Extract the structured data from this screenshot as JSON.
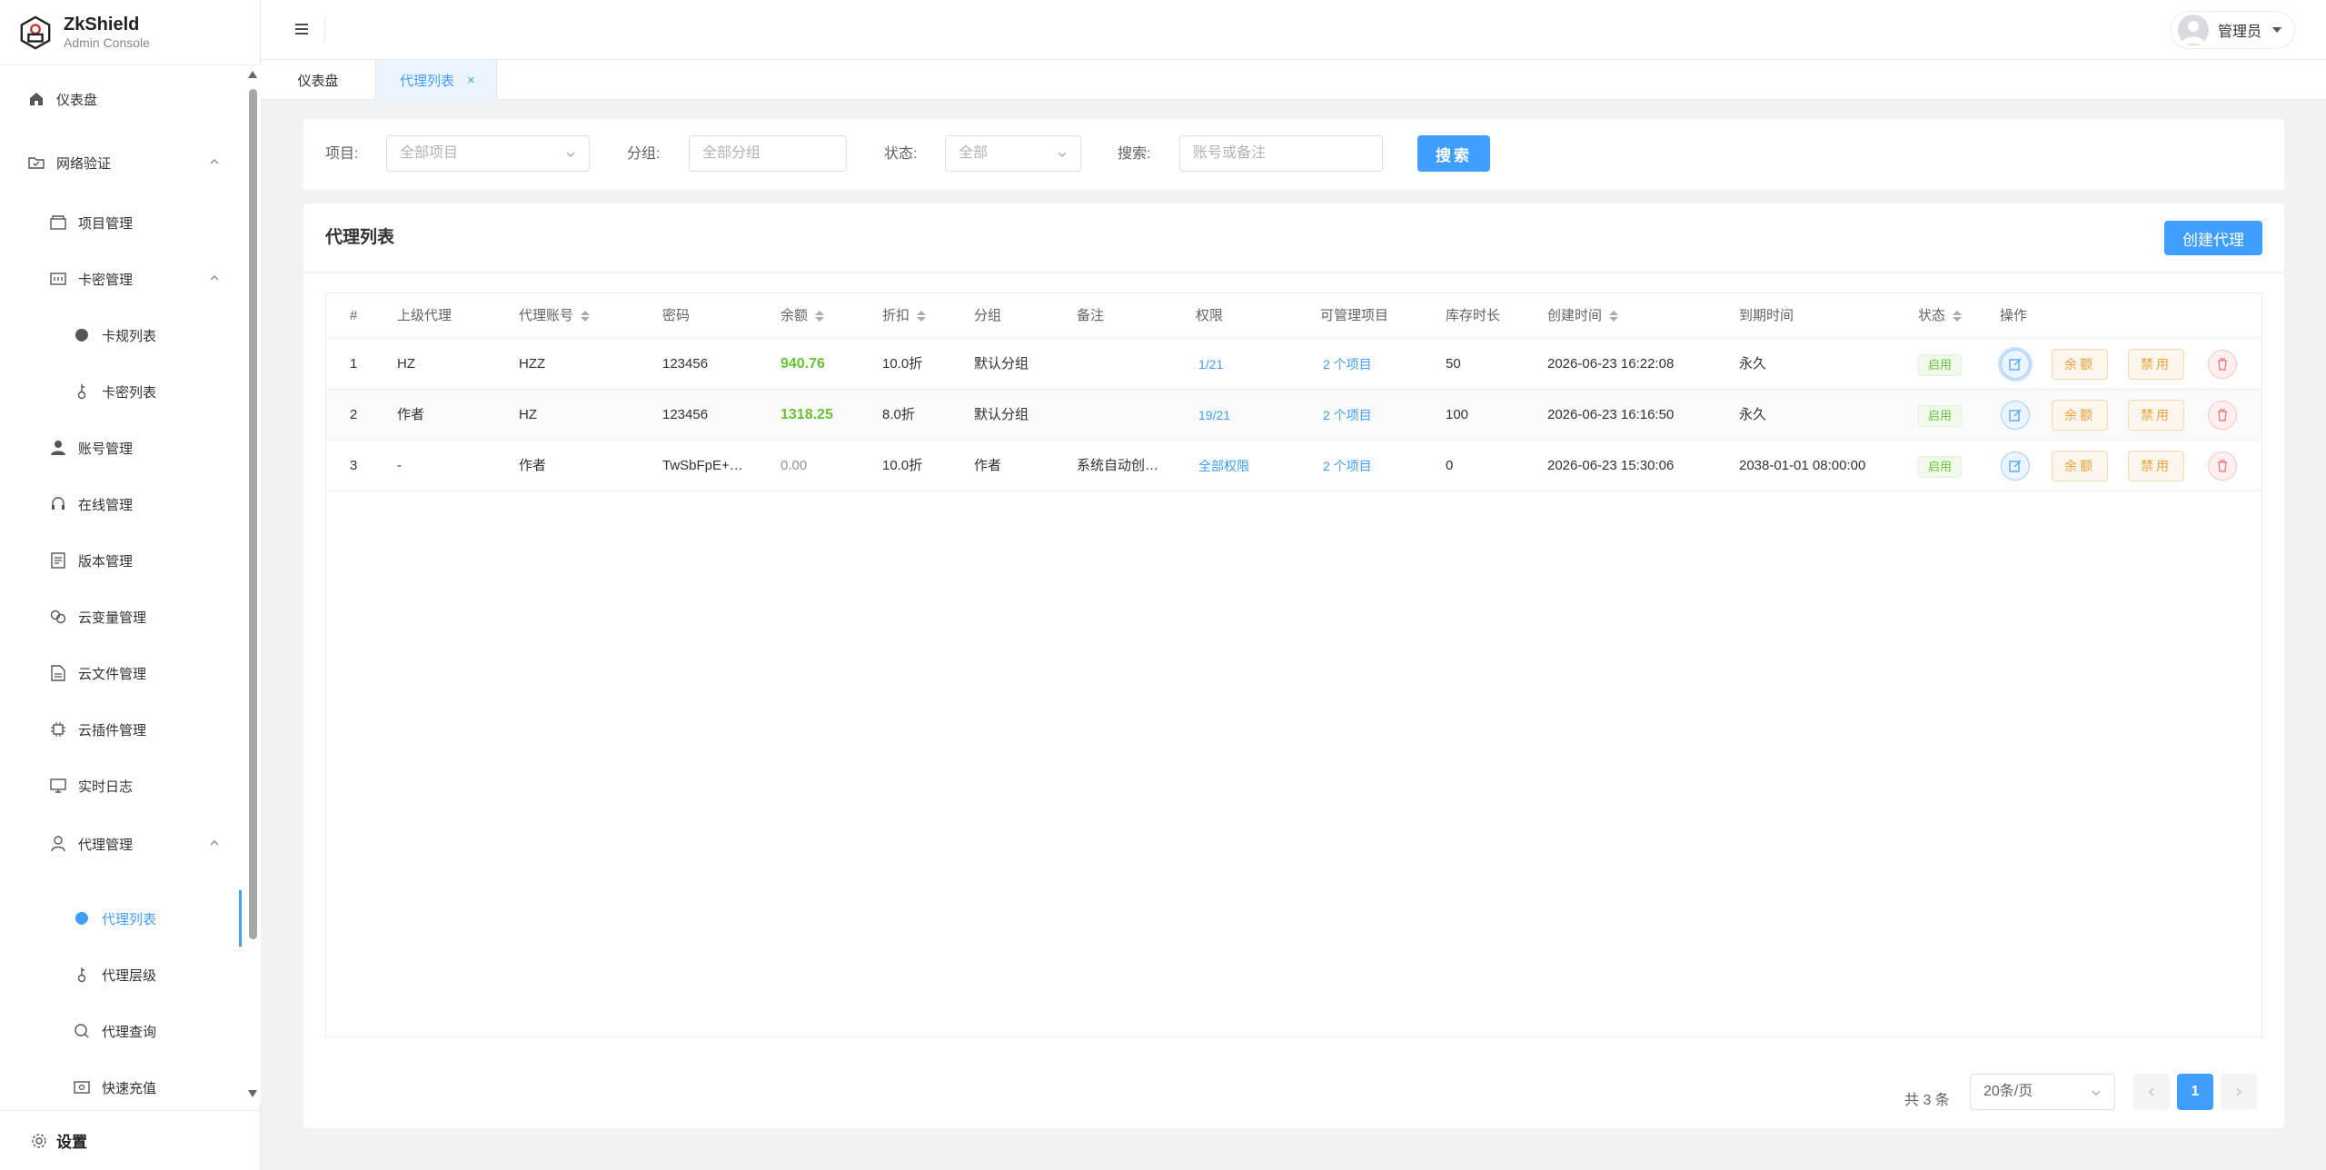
{
  "brand": {
    "name": "ZkShield",
    "subtitle": "Admin Console"
  },
  "sidebar": {
    "items": [
      {
        "label": "仪表盘",
        "icon": "home-icon"
      },
      {
        "label": "网络验证",
        "icon": "folder-check-icon"
      },
      {
        "label": "项目管理",
        "icon": "box-icon"
      },
      {
        "label": "卡密管理",
        "icon": "card-icon"
      },
      {
        "label": "卡规列表",
        "icon": "tag-icon"
      },
      {
        "label": "卡密列表",
        "icon": "key-icon"
      },
      {
        "label": "账号管理",
        "icon": "user-icon"
      },
      {
        "label": "在线管理",
        "icon": "headset-icon"
      },
      {
        "label": "版本管理",
        "icon": "document-icon"
      },
      {
        "label": "云变量管理",
        "icon": "link-icon"
      },
      {
        "label": "云文件管理",
        "icon": "file-icon"
      },
      {
        "label": "云插件管理",
        "icon": "chip-icon"
      },
      {
        "label": "实时日志",
        "icon": "monitor-icon"
      },
      {
        "label": "代理管理",
        "icon": "person-icon"
      },
      {
        "label": "代理列表",
        "icon": "tag-icon"
      },
      {
        "label": "代理层级",
        "icon": "key-icon"
      },
      {
        "label": "代理查询",
        "icon": "search-icon"
      },
      {
        "label": "快速充值",
        "icon": "wallet-icon"
      }
    ],
    "settings_label": "设置"
  },
  "topbar": {
    "user_name": "管理员"
  },
  "tabs": [
    {
      "label": "仪表盘"
    },
    {
      "label": "代理列表",
      "close": "×"
    }
  ],
  "filters": {
    "project_label": "项目:",
    "project_value": "全部项目",
    "group_label": "分组:",
    "group_placeholder": "全部分组",
    "status_label": "状态:",
    "status_value": "全部",
    "search_label": "搜索:",
    "search_placeholder": "账号或备注",
    "search_button": "搜索"
  },
  "card": {
    "title": "代理列表",
    "create_button": "创建代理"
  },
  "table": {
    "columns": [
      "#",
      "上级代理",
      "代理账号",
      "密码",
      "余额",
      "折扣",
      "分组",
      "备注",
      "权限",
      "可管理项目",
      "库存时长",
      "创建时间",
      "到期时间",
      "状态",
      "操作"
    ],
    "rows": [
      {
        "idx": "1",
        "parent": "HZ",
        "account": "HZZ",
        "password": "123456",
        "balance": "940.76",
        "discount": "10.0折",
        "group": "默认分组",
        "note": "",
        "perm": "1/21",
        "projects": "2 个项目",
        "stock": "50",
        "created": "2026-06-23 16:22:08",
        "expires": "永久",
        "status": "启用"
      },
      {
        "idx": "2",
        "parent": "作者",
        "account": "HZ",
        "password": "123456",
        "balance": "1318.25",
        "discount": "8.0折",
        "group": "默认分组",
        "note": "",
        "perm": "19/21",
        "projects": "2 个项目",
        "stock": "100",
        "created": "2026-06-23 16:16:50",
        "expires": "永久",
        "status": "启用"
      },
      {
        "idx": "3",
        "parent": "-",
        "account": "作者",
        "password": "TwSbFpE+…",
        "balance": "0.00",
        "discount": "10.0折",
        "group": "作者",
        "note": "系统自动创…",
        "perm": "全部权限",
        "projects": "2 个项目",
        "stock": "0",
        "created": "2026-06-23 15:30:06",
        "expires": "2038-01-01 08:00:00",
        "status": "启用"
      }
    ],
    "actions": {
      "balance": "余额",
      "disable": "禁用"
    }
  },
  "pagination": {
    "total": "共 3 条",
    "page_size": "20条/页",
    "current": "1"
  },
  "colors": {
    "primary": "#409eff",
    "success": "#67c23a",
    "warning": "#e6a23c",
    "danger": "#f56c6c"
  }
}
